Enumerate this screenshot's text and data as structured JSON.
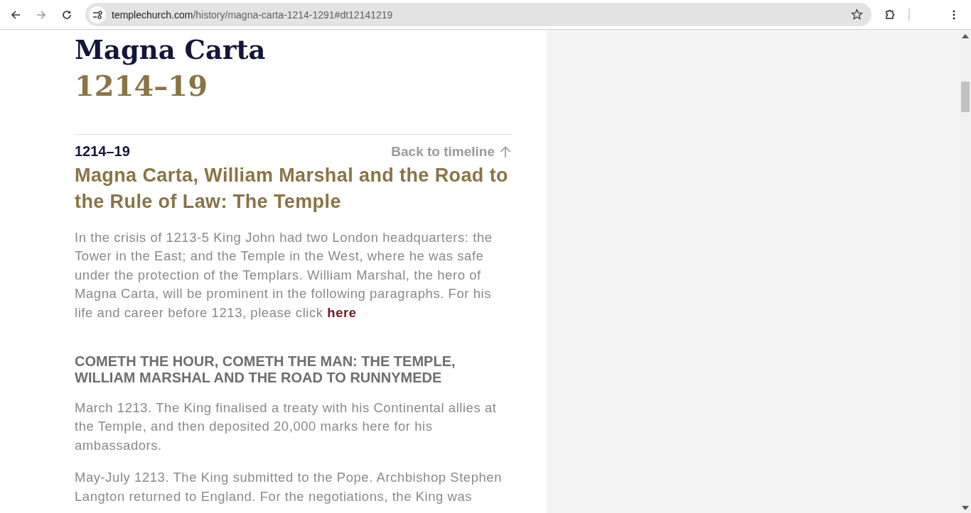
{
  "browser": {
    "url_host": "templechurch.com",
    "url_path": "/history/magna-carta-1214-1291#dt12141219"
  },
  "article": {
    "title": "Magna Carta",
    "title_dates": "1214–19",
    "entry_date": "1214–19",
    "back_link": "Back to timeline",
    "heading": "Magna Carta, William Marshal and the Road to the Rule of Law: The Temple",
    "intro": {
      "text": "In the crisis of 1213-5 King John had two London headquarters: the Tower in the East; and the Temple in the West, where he was safe under the protection of the Templars. William Marshal, the hero of Magna Carta, will be prominent in the following paragraphs. For his life and career before 1213, please click ",
      "link": "here"
    },
    "subheading": "COMETH THE HOUR, COMETH THE MAN: THE TEMPLE, WILLIAM MARSHAL AND THE ROAD TO RUNNYMEDE",
    "paragraphs": [
      "March 1213. The King finalised a treaty with his Continental allies at the Temple, and then deposited 20,000 marks here for his ambassadors.",
      "May-July 1213. The King submitted to the Pope. Archbishop Stephen Langton returned to England. For the negotiations, the King was"
    ]
  }
}
